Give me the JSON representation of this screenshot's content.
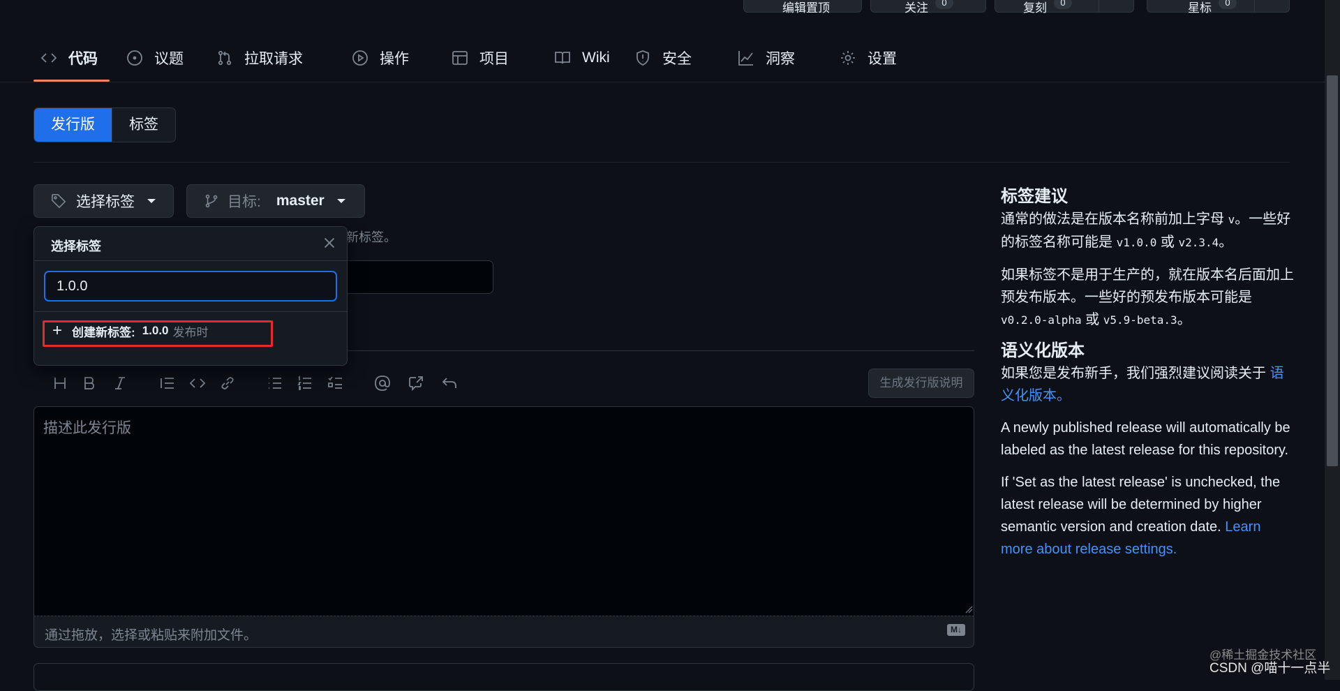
{
  "top_actions": {
    "edit_pins": "编辑置顶",
    "watch": "关注",
    "watch_count": "0",
    "fork": "复刻",
    "fork_count": "0",
    "star": "星标",
    "star_count": "0"
  },
  "nav": {
    "tabs": [
      {
        "label": "代码",
        "icon": "code-icon"
      },
      {
        "label": "议题",
        "icon": "issue-icon"
      },
      {
        "label": "拉取请求",
        "icon": "pull-request-icon"
      },
      {
        "label": "操作",
        "icon": "play-icon"
      },
      {
        "label": "项目",
        "icon": "table-icon"
      },
      {
        "label": "Wiki",
        "icon": "book-icon"
      },
      {
        "label": "安全",
        "icon": "shield-icon"
      },
      {
        "label": "洞察",
        "icon": "graph-icon"
      },
      {
        "label": "设置",
        "icon": "gear-icon"
      }
    ],
    "active_tab": "代码",
    "accent_color": "#f78166"
  },
  "segment": {
    "releases": "发行版",
    "tags": "标签"
  },
  "tag_button": {
    "label": "选择标签"
  },
  "target_button": {
    "prefix": "目标:",
    "branch": "master"
  },
  "hint_suffix": "新标签。",
  "dropdown": {
    "title": "选择标签",
    "input_value": "1.0.0",
    "create_label": "创建新标签:",
    "create_tag": "1.0.0",
    "create_suffix": "发布时"
  },
  "editor": {
    "generate_notes": "生成发行版说明",
    "placeholder": "描述此发行版",
    "attach_hint": "通过拖放，选择或粘贴来附加文件。",
    "md_badge": "M↓"
  },
  "sidebar": {
    "tag_title": "标签建议",
    "tag_p1_a": "通常的做法是在版本名称前加上字母",
    "tag_p1_v": "v",
    "tag_p1_b": "。一些好的标签名称可能是",
    "tag_p1_code1": "v1.0.0",
    "tag_p1_or": "或",
    "tag_p1_code2": "v2.3.4",
    "tag_p1_end": "。",
    "tag_p2_a": "如果标签不是用于生产的，就在版本名后面加上预发布版本。一些好的预发布版本可能是",
    "tag_p2_code1": "v0.2.0-alpha",
    "tag_p2_or": "或",
    "tag_p2_code2": "v5.9-beta.3",
    "tag_p2_end": "。",
    "semver_title": "语义化版本",
    "semver_p": "如果您是发布新手，我们强烈建议阅读关于",
    "semver_link": "语义化版本。",
    "latest_p": "A newly published release will automatically be labeled as the latest release for this repository.",
    "unchecked_p": "If 'Set as the latest release' is unchecked, the latest release will be determined by higher semantic version and creation date.",
    "learn_link": "Learn more about release settings."
  },
  "watermark": {
    "line1": "@稀土掘金技术社区",
    "line2": "CSDN @喵十一点半"
  }
}
